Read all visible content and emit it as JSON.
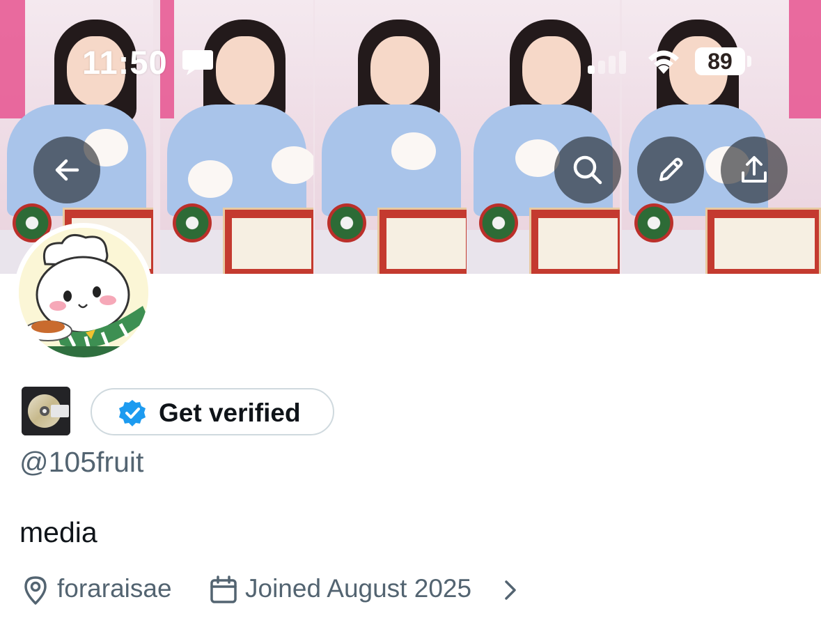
{
  "status_bar": {
    "time": "11:50",
    "battery": "89",
    "message_icon": "chat-bubble-icon",
    "signal_icon": "cellular-signal-icon",
    "wifi_icon": "wifi-icon"
  },
  "header": {
    "back_icon": "arrow-left-icon",
    "search_icon": "search-icon",
    "edit_icon": "pencil-icon",
    "share_icon": "share-upload-icon"
  },
  "profile": {
    "badge_emoji": "minidisc-emoji",
    "verify_label": "Get verified",
    "verify_icon": "verified-badge-icon",
    "handle": "@105fruit",
    "bio": "media",
    "location": "foraraisae",
    "location_icon": "location-pin-icon",
    "joined": "Joined August 2025",
    "joined_icon": "calendar-icon",
    "joined_more_icon": "chevron-right-icon"
  },
  "colors": {
    "secondary_text": "#536471",
    "primary_text": "#0f1419",
    "verified_blue": "#1d9bf0",
    "button_border": "#cfd9de"
  }
}
